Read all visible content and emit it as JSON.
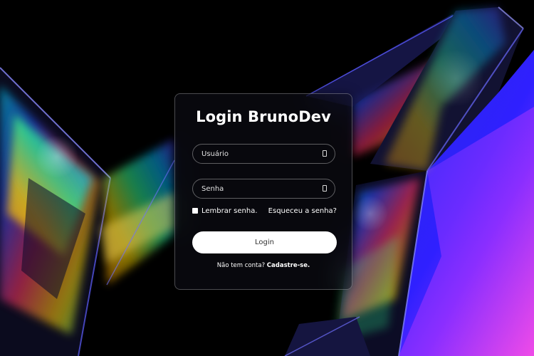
{
  "login": {
    "title": "Login BrunoDev",
    "username_placeholder": "Usuário",
    "password_placeholder": "Senha",
    "remember_label": "Lembrar senha.",
    "forgot_label": "Esqueceu a senha?",
    "submit_label": "Login",
    "signup_prompt": "Não tem conta?",
    "signup_link": "Cadastre-se."
  },
  "icons": {
    "username": "user-icon",
    "password": "lock-icon"
  },
  "colors": {
    "background": "#000000",
    "card_border": "#ffffff",
    "button_bg": "#ffffff",
    "button_text": "#333333",
    "accent_blue": "#2c2cff",
    "accent_purple": "#b040ff"
  }
}
